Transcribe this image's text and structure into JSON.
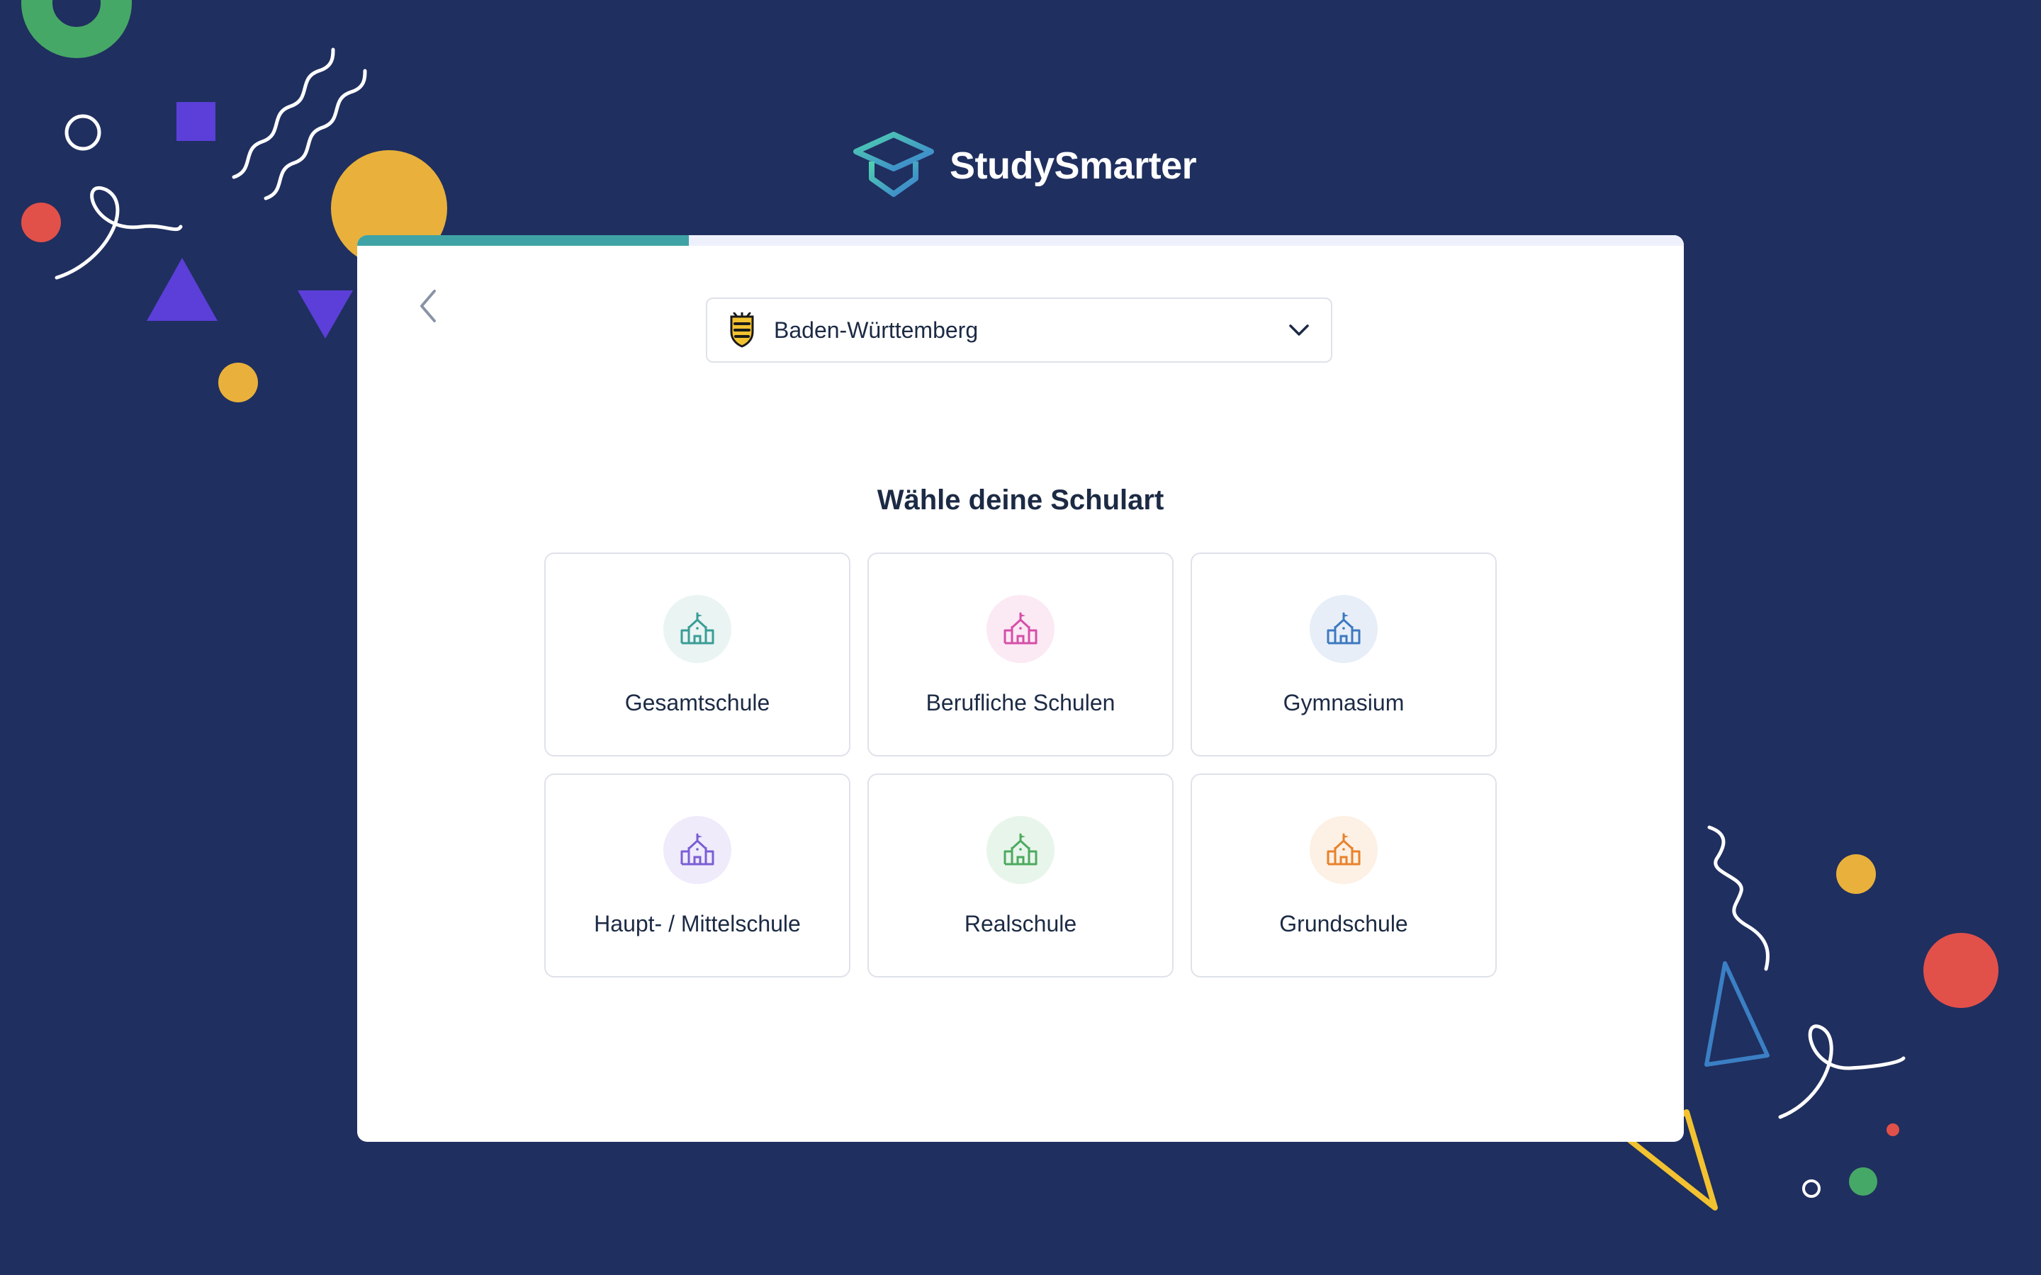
{
  "brand": {
    "name": "StudySmarter",
    "logo_icon": "graduation-cap-cube-logo"
  },
  "onboarding": {
    "progress_fraction": 0.25,
    "back_icon": "chevron-left-icon",
    "state_select": {
      "value": "Baden-Württemberg",
      "flag_icon": "baden-wuerttemberg-coat-of-arms-icon",
      "chevron_icon": "chevron-down-icon"
    },
    "heading": "Wähle deine Schulart",
    "school_types": [
      {
        "label": "Gesamtschule",
        "icon": "school-building-icon",
        "color": "#3a9d96",
        "bg": "#e9f4f3"
      },
      {
        "label": "Berufliche Schulen",
        "icon": "school-building-icon",
        "color": "#d64fa8",
        "bg": "#fbe9f4"
      },
      {
        "label": "Gymnasium",
        "icon": "school-building-icon",
        "color": "#3d79c0",
        "bg": "#e7eef8"
      },
      {
        "label": "Haupt- / Mittelschule",
        "icon": "school-building-icon",
        "color": "#7b5dd6",
        "bg": "#efebfb"
      },
      {
        "label": "Realschule",
        "icon": "school-building-icon",
        "color": "#4caa5f",
        "bg": "#e8f5eb"
      },
      {
        "label": "Grundschule",
        "icon": "school-building-icon",
        "color": "#e8822d",
        "bg": "#fdf0e4"
      }
    ]
  },
  "colors": {
    "background": "#1f2f5f",
    "progress": "#3fa3a6",
    "text": "#1c2a44"
  }
}
